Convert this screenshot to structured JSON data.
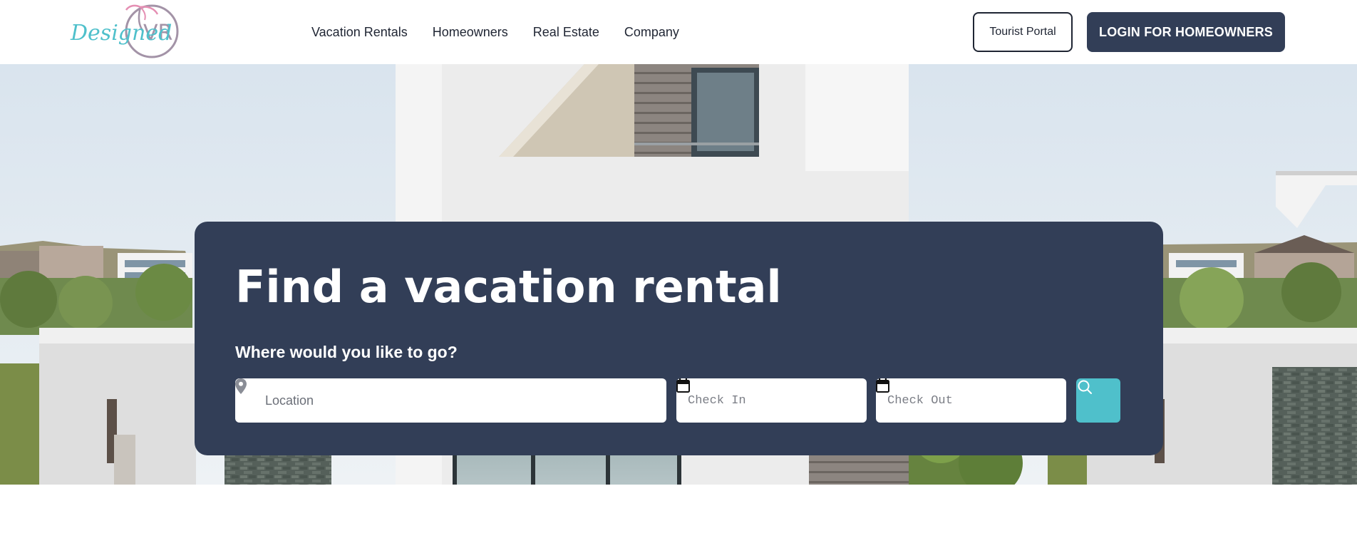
{
  "brand": {
    "logo_alt": "DesignedVR",
    "logo_script_text": "Designed",
    "logo_mark_text": "VR",
    "colors": {
      "navy": "#323e57",
      "teal": "#4fc0cb",
      "logo_mauve": "#a393a7"
    }
  },
  "nav": {
    "items": [
      {
        "label": "Vacation Rentals"
      },
      {
        "label": "Homeowners"
      },
      {
        "label": "Real Estate"
      },
      {
        "label": "Company"
      }
    ]
  },
  "header_actions": {
    "tourist_portal_label": "Tourist Portal",
    "login_label": "LOGIN FOR HOMEOWNERS"
  },
  "search": {
    "title": "Find a vacation rental",
    "subtitle": "Where would you like to go?",
    "location_placeholder": "Location",
    "checkin_placeholder": "Check In",
    "checkout_placeholder": "Check Out",
    "icons": {
      "location": "map-pin-icon",
      "date": "calendar-icon",
      "submit": "search-icon"
    }
  }
}
